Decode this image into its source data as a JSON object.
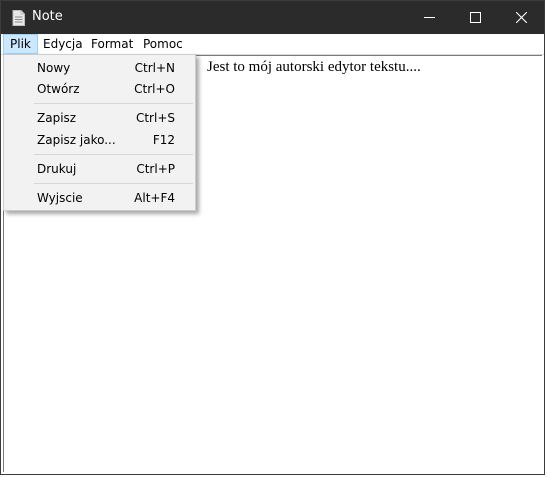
{
  "window": {
    "title": "Note",
    "controls": [
      "minimize-icon",
      "maximize-icon",
      "close-icon"
    ]
  },
  "menubar": {
    "items": [
      {
        "label": "Plik",
        "active": true
      },
      {
        "label": "Edycja"
      },
      {
        "label": "Format"
      },
      {
        "label": "Pomoc"
      }
    ]
  },
  "file_menu": {
    "items": [
      {
        "label": "Nowy",
        "shortcut": "Ctrl+N"
      },
      {
        "label": "Otwórz",
        "shortcut": "Ctrl+O"
      },
      {
        "label": "Zapisz",
        "shortcut": "Ctrl+S"
      },
      {
        "label": "Zapisz jako...",
        "shortcut": "F12"
      },
      {
        "label": "Drukuj",
        "shortcut": "Ctrl+P"
      },
      {
        "label": "Wyjscie",
        "shortcut": "Alt+F4"
      }
    ]
  },
  "editor": {
    "text": "Jest to mój autorski edytor tekstu...."
  },
  "colors": {
    "titlebar": "#2b2b2b",
    "menu_highlight": "#cce8ff",
    "dropdown_bg": "#f2f2f2"
  }
}
